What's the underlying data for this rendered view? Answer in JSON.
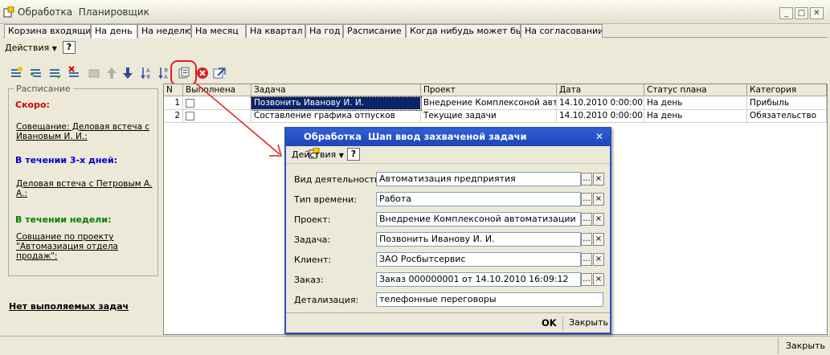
{
  "window": {
    "title": "Обработка  Планировщик",
    "buttons": {
      "minimize": "_",
      "maximize": "□",
      "close": "✕"
    }
  },
  "tabs": [
    {
      "label": "Корзина входящие"
    },
    {
      "label": "На день",
      "active": true
    },
    {
      "label": "На неделю"
    },
    {
      "label": "На месяц"
    },
    {
      "label": "На квартал"
    },
    {
      "label": "На год"
    },
    {
      "label": "Расписание"
    },
    {
      "label": "Когда нибудь может быть"
    },
    {
      "label": "На согласовании"
    }
  ],
  "actionbar": {
    "actions_label": "Действия",
    "help_label": "?"
  },
  "toolbar_icons": [
    "add-icon",
    "add-subtask-icon",
    "copy-row-icon",
    "delete-row-icon",
    "disabled-icon",
    "move-up-icon",
    "move-down-icon",
    "sort-asc-icon",
    "sort-desc-icon",
    "capture-task-icon",
    "cancel-icon",
    "export-icon"
  ],
  "schedule": {
    "legend": "Расписание",
    "soon_header": "Скоро:",
    "soon_item": "Совещание: Деловая встеча с Ивановым И. И.:",
    "three_days_header": "В течении 3-х дней:",
    "three_days_item": "Деловая встеча с Петровым А. А.:",
    "week_header": "В течении недели:",
    "week_item": "Совщание по проекту \"Автомазиация отдела продаж\":",
    "no_tasks": "Нет выполяемых задач"
  },
  "grid": {
    "columns": [
      "N",
      "Выполнена",
      "Задача",
      "Проект",
      "Дата",
      "Статус плана",
      "Категория"
    ],
    "rows": [
      {
        "n": "1",
        "done": false,
        "task": "Позвонить Иванову И. И.",
        "project": "Внедрение Комплексоной авт...",
        "date": "14.10.2010 0:00:00",
        "status": "На день",
        "category": "Прибыль"
      },
      {
        "n": "2",
        "done": false,
        "task": "Составление графика отпусков",
        "project": "Текущие задачи",
        "date": "14.10.2010 0:00:00",
        "status": "На день",
        "category": "Обязательство"
      }
    ]
  },
  "statusbar": {
    "close_label": "Закрыть"
  },
  "dialog": {
    "title": "Обработка  Шап ввод захваченой задачи",
    "close": "✕",
    "actions_label": "Действия",
    "help_label": "?",
    "fields": [
      {
        "label": "Вид деятельности:",
        "value": "Автоматизация предприятия"
      },
      {
        "label": "Тип времени:",
        "value": "Работа"
      },
      {
        "label": "Проект:",
        "value": "Внедрение Комплексоной автоматизации"
      },
      {
        "label": "Задача:",
        "value": "Позвонить Иванову И. И."
      },
      {
        "label": "Клиент:",
        "value": "ЗАО Росбытсервис"
      },
      {
        "label": "Заказ:",
        "value": "Заказ 000000001 от 14.10.2010 16:09:12"
      },
      {
        "label": "Детализация:",
        "value": "телефонные переговоры"
      }
    ],
    "pick_label": "...",
    "clear_label": "×",
    "ok_label": "OK",
    "close_label": "Закрыть"
  },
  "colors": {
    "dialog_title": "#2f5fd8",
    "selection": "#0a246a",
    "highlight_ring": "#e02020",
    "arrow": "#e02020"
  }
}
